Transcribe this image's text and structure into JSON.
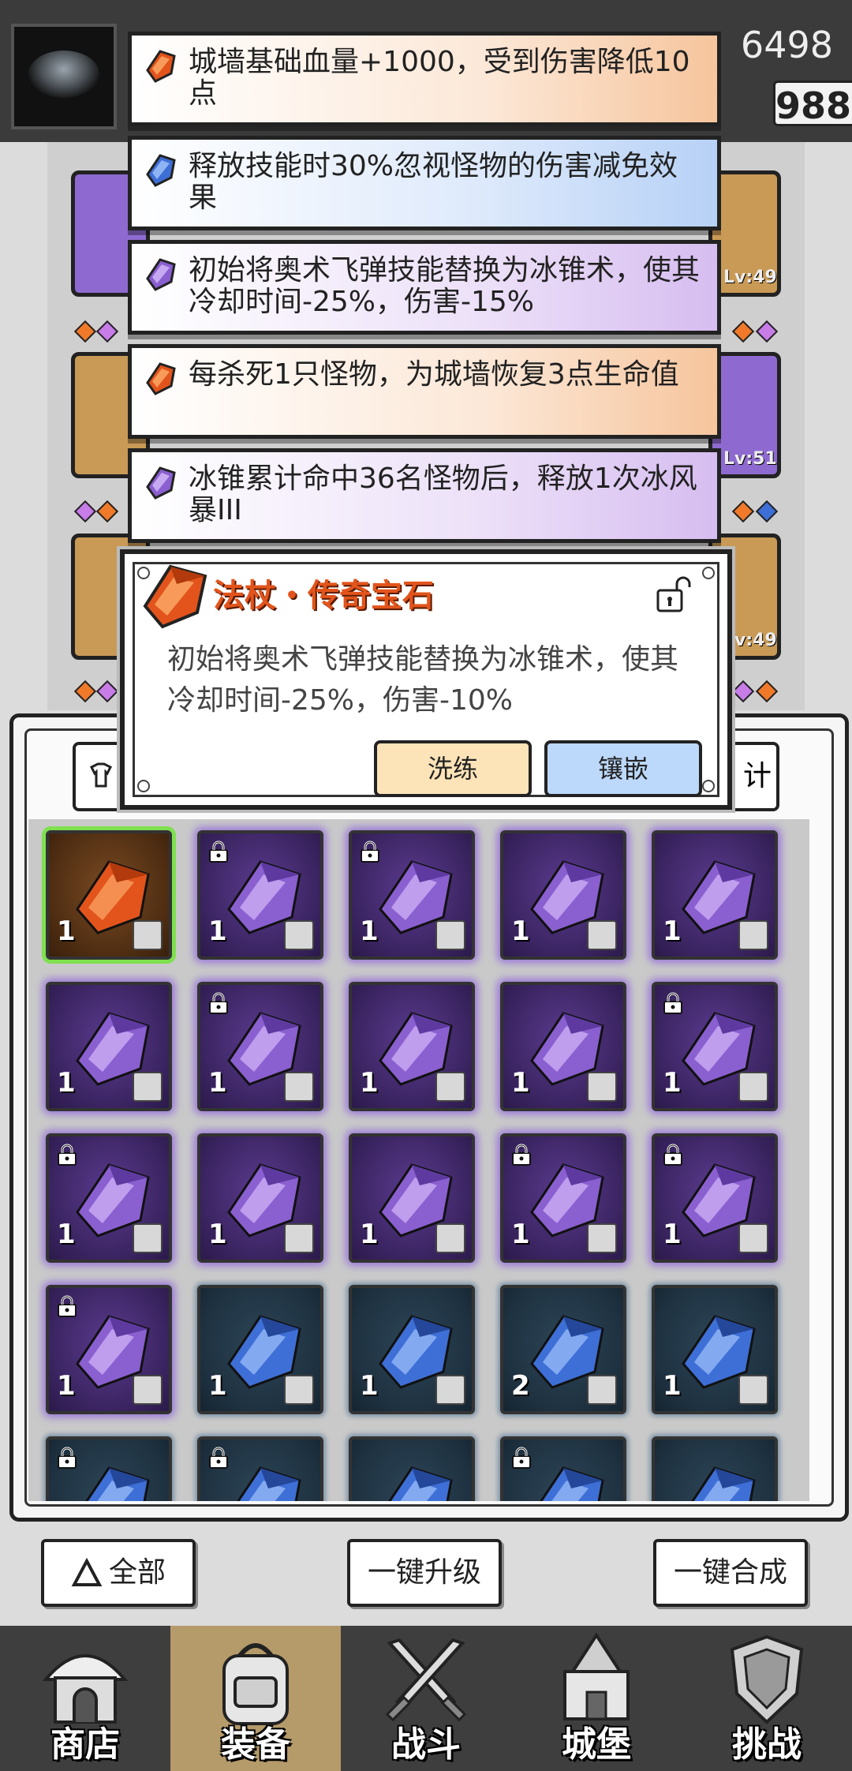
{
  "resources": {
    "value1": "6498",
    "value2": "988"
  },
  "equip_levels": {
    "r1": "Lv:49",
    "r2": "Lv:51",
    "r3": "Lv:49"
  },
  "tooltips": [
    {
      "color": "orange",
      "text": "城墙基础血量+1000，受到伤害降低10点"
    },
    {
      "color": "blue",
      "text": "释放技能时30%忽视怪物的伤害减免效果"
    },
    {
      "color": "purple",
      "text": "初始将奥术飞弹技能替换为冰锥术，使其冷却时间-25%，伤害-15%"
    },
    {
      "color": "orange",
      "text": "每杀死1只怪物，为城墙恢复3点生命值"
    },
    {
      "color": "purple",
      "text": "冰锥累计命中36名怪物后，释放1次冰风暴III"
    }
  ],
  "popup": {
    "title": "法杖・传奇宝石",
    "description": "初始将奥术飞弹技能替换为冰锥术，使其冷却时间-25%，伤害-10%",
    "refine_label": "洗练",
    "inlay_label": "镶嵌"
  },
  "panel_tab_partial": "计",
  "grid": [
    [
      {
        "c": "o",
        "n": "1",
        "lock": false
      },
      {
        "c": "p",
        "n": "1",
        "lock": true
      },
      {
        "c": "p",
        "n": "1",
        "lock": true
      },
      {
        "c": "p",
        "n": "1",
        "lock": false
      },
      {
        "c": "p",
        "n": "1",
        "lock": false
      }
    ],
    [
      {
        "c": "p",
        "n": "1",
        "lock": false
      },
      {
        "c": "p",
        "n": "1",
        "lock": true
      },
      {
        "c": "p",
        "n": "1",
        "lock": false
      },
      {
        "c": "p",
        "n": "1",
        "lock": false
      },
      {
        "c": "p",
        "n": "1",
        "lock": true
      }
    ],
    [
      {
        "c": "p",
        "n": "1",
        "lock": true
      },
      {
        "c": "p",
        "n": "1",
        "lock": false
      },
      {
        "c": "p",
        "n": "1",
        "lock": false
      },
      {
        "c": "p",
        "n": "1",
        "lock": true
      },
      {
        "c": "p",
        "n": "1",
        "lock": true
      }
    ],
    [
      {
        "c": "p",
        "n": "1",
        "lock": true
      },
      {
        "c": "b",
        "n": "1",
        "lock": false
      },
      {
        "c": "b",
        "n": "1",
        "lock": false
      },
      {
        "c": "b",
        "n": "2",
        "lock": false
      },
      {
        "c": "b",
        "n": "1",
        "lock": false
      }
    ],
    [
      {
        "c": "b",
        "n": "",
        "lock": true
      },
      {
        "c": "b",
        "n": "",
        "lock": true
      },
      {
        "c": "b",
        "n": "",
        "lock": false
      },
      {
        "c": "b",
        "n": "",
        "lock": true
      },
      {
        "c": "b",
        "n": "",
        "lock": false
      }
    ]
  ],
  "buttons": {
    "all": "全部",
    "upgrade": "一键升级",
    "merge": "一键合成"
  },
  "nav": [
    {
      "label": "商店",
      "icon": "shop-icon",
      "active": false
    },
    {
      "label": "装备",
      "icon": "backpack-icon",
      "active": true
    },
    {
      "label": "战斗",
      "icon": "swords-icon",
      "active": false
    },
    {
      "label": "城堡",
      "icon": "castle-icon",
      "active": false
    },
    {
      "label": "挑战",
      "icon": "shield-icon",
      "active": false
    }
  ],
  "colors": {
    "orange_gem": "#e2541c",
    "purple_gem": "#8a5fd0",
    "blue_gem": "#3e6fd6",
    "accent_green": "#7fe04f"
  }
}
